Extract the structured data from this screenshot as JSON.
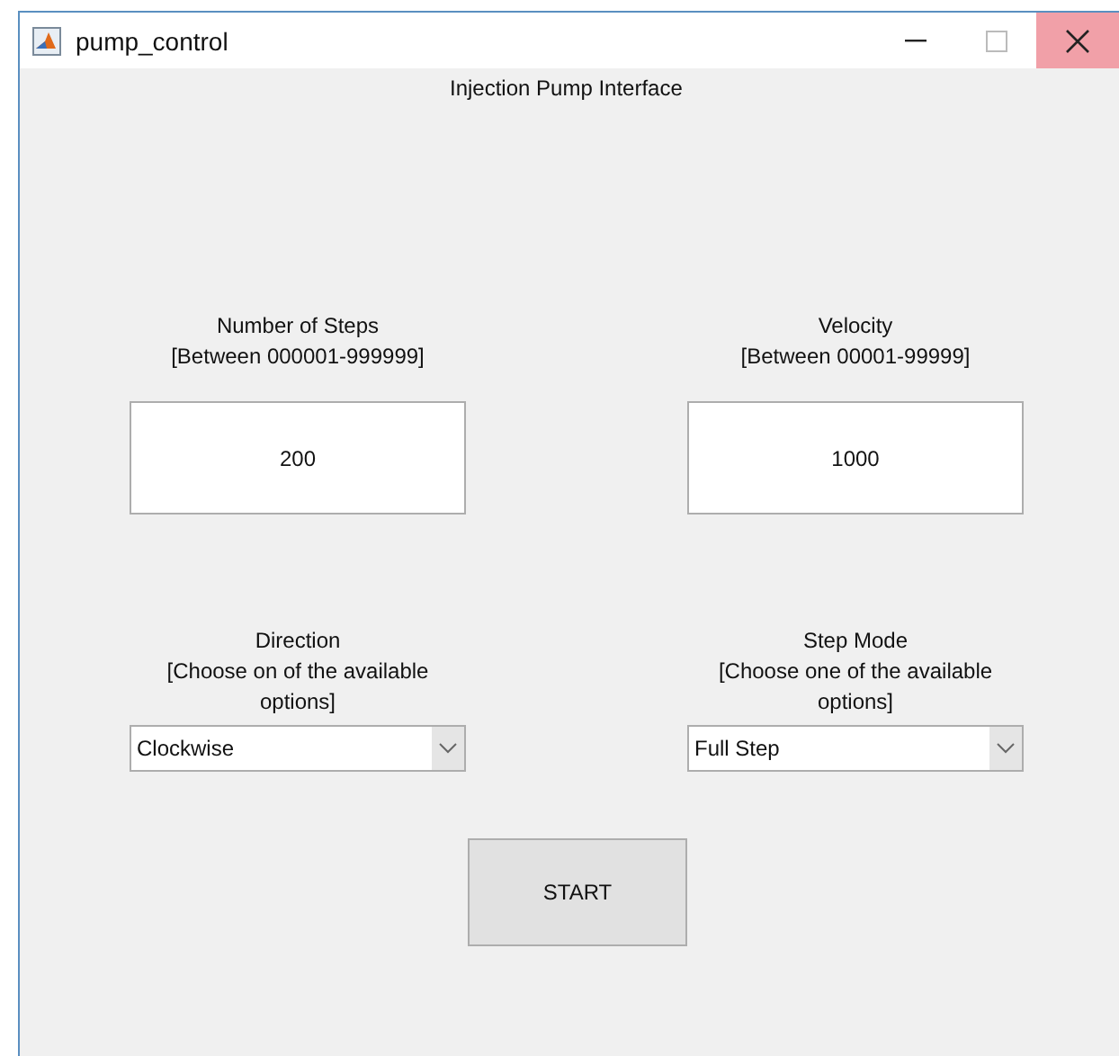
{
  "window": {
    "title": "pump_control"
  },
  "heading": "Injection Pump Interface",
  "inputs": [
    {
      "label_lines": [
        "Number of Steps",
        "[Between 000001-999999]"
      ],
      "value": "200"
    },
    {
      "label_lines": [
        "Velocity",
        "[Between 00001-99999]"
      ],
      "value": "1000"
    }
  ],
  "dropdowns": [
    {
      "label_lines": [
        "Direction",
        "[Choose on of the available",
        "options]"
      ],
      "value": "Clockwise"
    },
    {
      "label_lines": [
        "Step Mode",
        "[Choose one of the available",
        "options]"
      ],
      "value": "Full Step"
    }
  ],
  "buttons": [
    "START"
  ]
}
